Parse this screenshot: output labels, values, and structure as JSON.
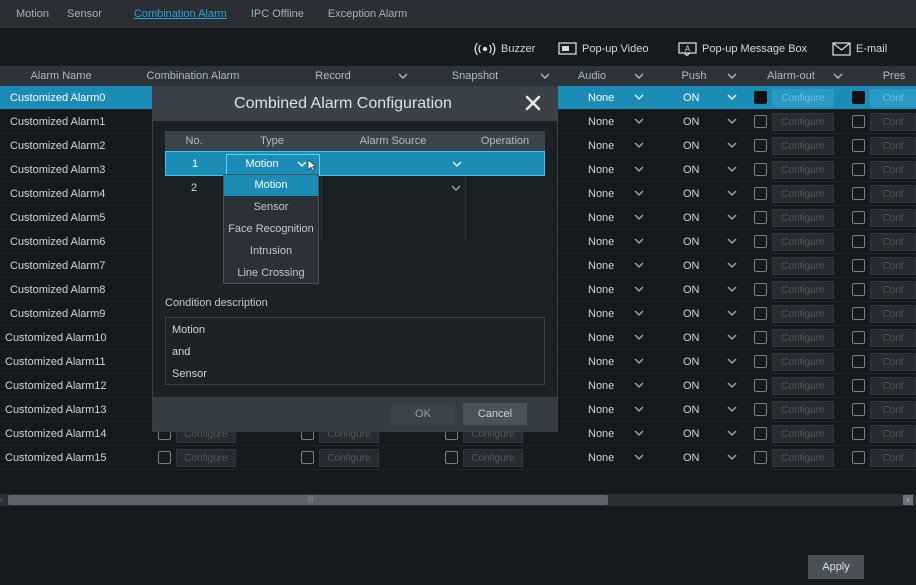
{
  "tabs": [
    {
      "label": "Motion",
      "active": false
    },
    {
      "label": "Sensor",
      "active": false
    },
    {
      "label": "Combination Alarm",
      "active": true
    },
    {
      "label": "IPC Offline",
      "active": false
    },
    {
      "label": "Exception Alarm",
      "active": false
    }
  ],
  "toolbar": {
    "buzzer": "Buzzer",
    "popup_video": "Pop-up Video",
    "popup_message": "Pop-up Message Box",
    "email": "E-mail"
  },
  "columns": {
    "alarm_name": "Alarm Name",
    "combination_alarm": "Combination Alarm",
    "record": "Record",
    "snapshot": "Snapshot",
    "audio": "Audio",
    "push": "Push",
    "alarm_out": "Alarm-out",
    "preset": "Pres"
  },
  "rows": [
    {
      "name": "Customized Alarm0",
      "audio": "None",
      "push": "ON",
      "selected": true
    },
    {
      "name": "Customized Alarm1",
      "audio": "None",
      "push": "ON"
    },
    {
      "name": "Customized Alarm2",
      "audio": "None",
      "push": "ON"
    },
    {
      "name": "Customized Alarm3",
      "audio": "None",
      "push": "ON"
    },
    {
      "name": "Customized Alarm4",
      "audio": "None",
      "push": "ON"
    },
    {
      "name": "Customized Alarm5",
      "audio": "None",
      "push": "ON"
    },
    {
      "name": "Customized Alarm6",
      "audio": "None",
      "push": "ON"
    },
    {
      "name": "Customized Alarm7",
      "audio": "None",
      "push": "ON"
    },
    {
      "name": "Customized Alarm8",
      "audio": "None",
      "push": "ON"
    },
    {
      "name": "Customized Alarm9",
      "audio": "None",
      "push": "ON"
    },
    {
      "name": "Customized Alarm10",
      "audio": "None",
      "push": "ON"
    },
    {
      "name": "Customized Alarm11",
      "audio": "None",
      "push": "ON"
    },
    {
      "name": "Customized Alarm12",
      "audio": "None",
      "push": "ON"
    },
    {
      "name": "Customized Alarm13",
      "audio": "None",
      "push": "ON"
    },
    {
      "name": "Customized Alarm14",
      "audio": "None",
      "push": "ON"
    },
    {
      "name": "Customized Alarm15",
      "audio": "None",
      "push": "ON"
    }
  ],
  "configure_label": "Configure",
  "preset_configure_label": "Conf",
  "apply_label": "Apply",
  "modal": {
    "title": "Combined Alarm Configuration",
    "headers": {
      "no": "No.",
      "type": "Type",
      "source": "Alarm Source",
      "operation": "Operation"
    },
    "rows": [
      {
        "no": "1",
        "type": "Motion"
      },
      {
        "no": "2",
        "type": ""
      }
    ],
    "dropdown_options": [
      "Motion",
      "Sensor",
      "Face Recognition",
      "Intrusion",
      "Line Crossing"
    ],
    "condition_label": "Condition description",
    "condition_lines": [
      "Motion",
      "and",
      "Sensor"
    ],
    "ok_label": "OK",
    "cancel_label": "Cancel"
  },
  "colors": {
    "accent": "#1a8cb6",
    "tab_active": "#27a6d8",
    "background": "#16191e"
  }
}
